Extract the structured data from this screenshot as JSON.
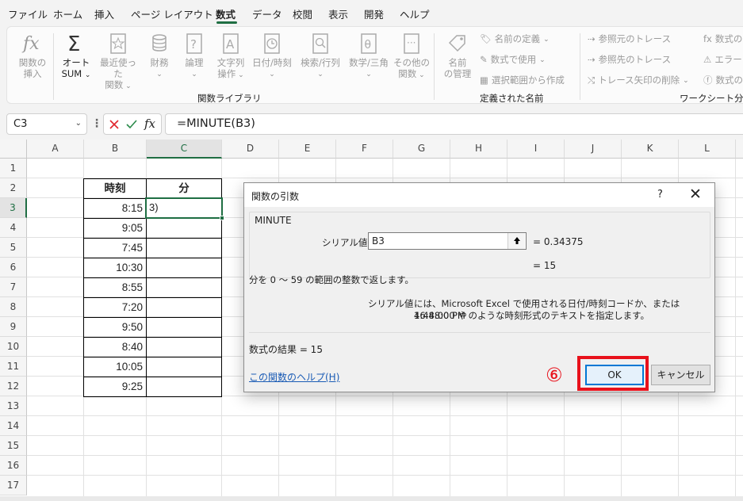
{
  "menu": {
    "tabs": [
      "ファイル",
      "ホーム",
      "挿入",
      "ページ レイアウト",
      "数式",
      "データ",
      "校閲",
      "表示",
      "開発",
      "ヘルプ"
    ],
    "active": "数式"
  },
  "ribbon": {
    "function_library": {
      "insert_function": [
        "関数の",
        "挿入"
      ],
      "autosum": [
        "オート",
        "SUM"
      ],
      "recent": [
        "最近使った",
        "関数"
      ],
      "financial": "財務",
      "logical": "論理",
      "text": [
        "文字列",
        "操作"
      ],
      "datetime": "日付/時刻",
      "lookup": "検索/行列",
      "math": "数学/三角",
      "more": [
        "その他の",
        "関数"
      ],
      "group_label": "関数ライブラリ"
    },
    "defined_names": {
      "name_manager": [
        "名前",
        "の管理"
      ],
      "define_name": "名前の定義",
      "use_in_formula": "数式で使用",
      "create_from_selection": "選択範囲から作成",
      "group_label": "定義された名前"
    },
    "formula_auditing": {
      "trace_precedents": "参照元のトレース",
      "trace_dependents": "参照先のトレース",
      "remove_arrows": "トレース矢印の削除",
      "show_formulas": "数式の",
      "error_checking": "エラー",
      "evaluate": "数式の",
      "group_label": "ワークシート分析"
    }
  },
  "formula_bar": {
    "name_box": "C3",
    "formula": "=MINUTE(B3)",
    "fx": "fx"
  },
  "sheet": {
    "columns": [
      "A",
      "B",
      "C",
      "D",
      "E",
      "F",
      "G",
      "H",
      "I",
      "J",
      "K",
      "L"
    ],
    "rows": [
      "1",
      "2",
      "3",
      "4",
      "5",
      "6",
      "7",
      "8",
      "9",
      "10",
      "11",
      "12",
      "13",
      "14",
      "15",
      "16",
      "17"
    ],
    "table": {
      "header_time": "時刻",
      "header_minute": "分",
      "times": [
        "8:15",
        "9:05",
        "7:45",
        "10:30",
        "8:55",
        "7:20",
        "9:50",
        "8:40",
        "10:05",
        "9:25"
      ]
    },
    "active_cell": "C3",
    "active_cell_text": "3)"
  },
  "dialog": {
    "title": "関数の引数",
    "help_glyph": "?",
    "close_glyph": "✕",
    "function_name": "MINUTE",
    "arg_label": "シリアル値",
    "arg_value": "B3",
    "arg_result": "=  0.34375",
    "func_result": "=  15",
    "description": "分を 0 ～ 59 の範囲の整数で返します。",
    "arg_desc_label": "シリアル値",
    "arg_desc": [
      "には、Microsoft Excel で使用される日付/時刻コードか、または 16:48:00 や",
      "4:48:00 PM のような時刻形式のテキストを指定します。"
    ],
    "formula_result": "数式の結果 =   15",
    "help_link": "この関数のヘルプ(H)",
    "ok_label": "OK",
    "cancel_label": "キャンセル"
  },
  "annotation": {
    "step": "⑥",
    "color": "#e8111b"
  },
  "colors": {
    "accent": "#1f6e43",
    "dialog_ok_border": "#0078d4",
    "link": "#1a5bb5"
  }
}
